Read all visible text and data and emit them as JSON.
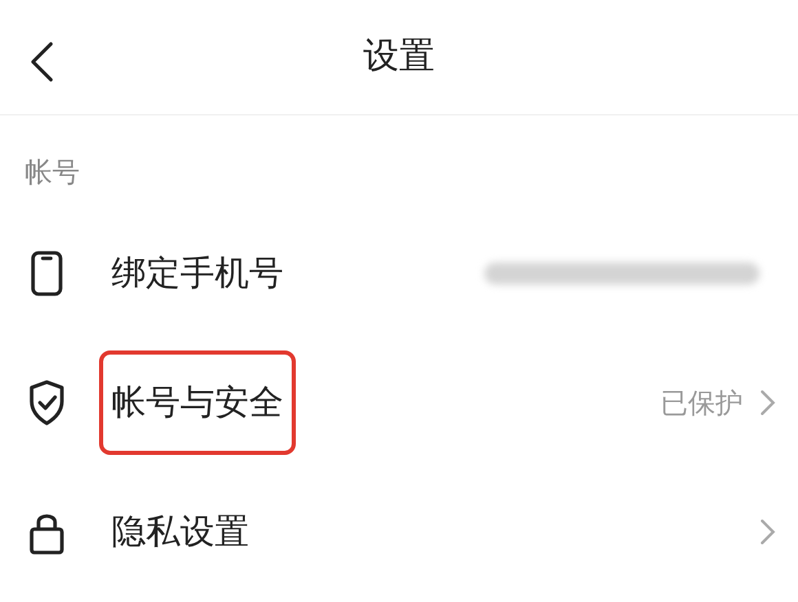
{
  "header": {
    "title": "设置"
  },
  "section": {
    "label": "帐号"
  },
  "rows": [
    {
      "kind": "phone",
      "label": "绑定手机号",
      "redacted": true,
      "chevron": false,
      "highlighted": false
    },
    {
      "kind": "shield",
      "label": "帐号与安全",
      "value": "已保护",
      "redacted": false,
      "chevron": true,
      "highlighted": true
    },
    {
      "kind": "lock",
      "label": "隐私设置",
      "redacted": false,
      "chevron": true,
      "highlighted": false
    }
  ]
}
